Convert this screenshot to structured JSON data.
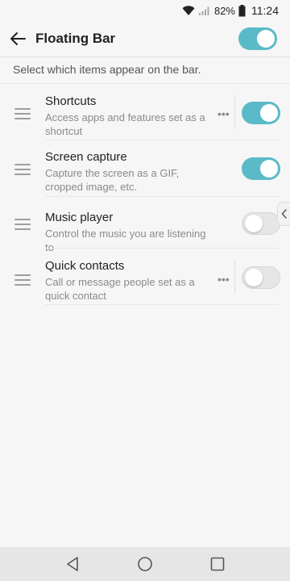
{
  "status": {
    "battery_pct": "82%",
    "time": "11:24"
  },
  "header": {
    "title": "Floating Bar",
    "master_toggle_on": true
  },
  "subtitle": "Select which items appear on the bar.",
  "items": [
    {
      "title": "Shortcuts",
      "description": "Access apps and features set as a shortcut",
      "has_more": true,
      "enabled": true
    },
    {
      "title": "Screen capture",
      "description": "Capture the screen as a GIF, cropped image, etc.",
      "has_more": false,
      "enabled": true
    },
    {
      "title": "Music player",
      "description": "Control the music you are listening to",
      "has_more": false,
      "enabled": false
    },
    {
      "title": "Quick contacts",
      "description": "Call or message people set as a quick contact",
      "has_more": true,
      "enabled": false
    }
  ],
  "more_glyph": "•••",
  "colors": {
    "accent": "#5bbac7",
    "toggle_off": "#e6e6e6",
    "nav_bar": "#e6e6e6"
  },
  "icons": {
    "wifi": "wifi-icon",
    "signal": "signal-icon",
    "battery": "battery-icon",
    "back": "back-arrow-icon",
    "drag": "drag-handle-icon",
    "more": "more-horizontal-icon",
    "edge": "chevron-left-icon",
    "nav_back": "nav-back-icon",
    "nav_home": "nav-home-icon",
    "nav_recent": "nav-recent-icon"
  }
}
